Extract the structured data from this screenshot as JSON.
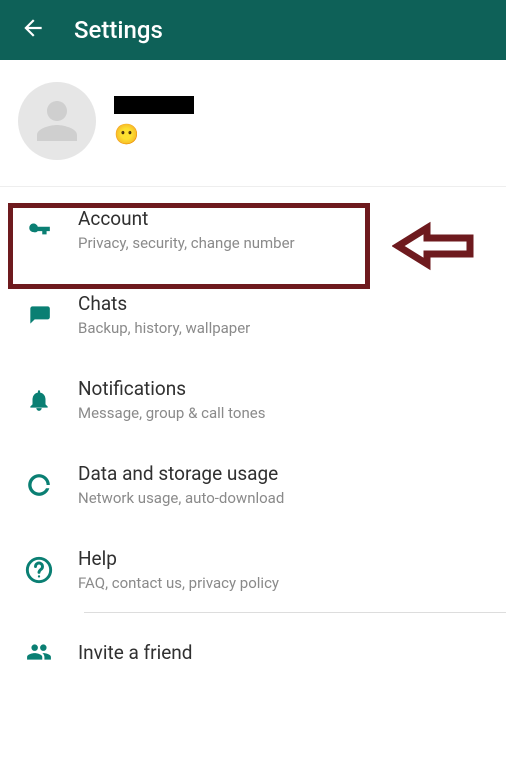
{
  "header": {
    "title": "Settings"
  },
  "profile": {
    "emoji": "😶"
  },
  "items": {
    "account": {
      "title": "Account",
      "sub": "Privacy, security, change number"
    },
    "chats": {
      "title": "Chats",
      "sub": "Backup, history, wallpaper"
    },
    "notifs": {
      "title": "Notifications",
      "sub": "Message, group & call tones"
    },
    "data": {
      "title": "Data and storage usage",
      "sub": "Network usage, auto-download"
    },
    "help": {
      "title": "Help",
      "sub": "FAQ, contact us, privacy policy"
    },
    "invite": {
      "title": "Invite a friend"
    }
  }
}
